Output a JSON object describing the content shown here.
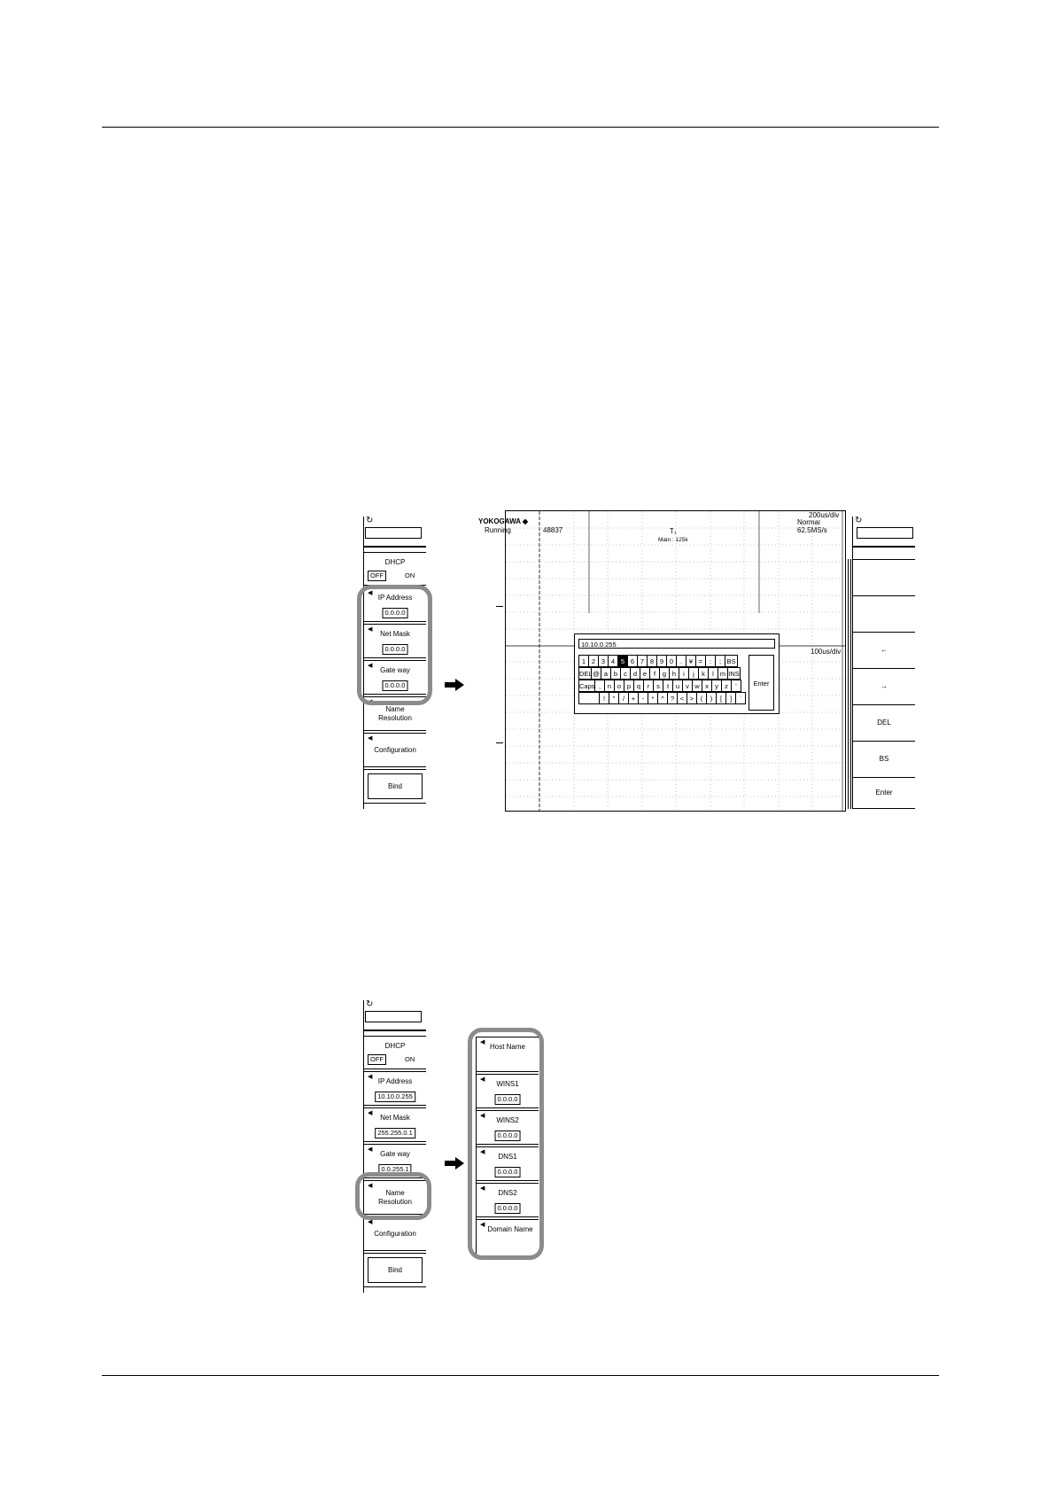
{
  "figure1": {
    "left_menu": {
      "dhcp": {
        "label": "DHCP",
        "off": "OFF",
        "on": "ON"
      },
      "ip_address": {
        "label": "IP Address",
        "value": "0.0.0.0"
      },
      "net_mask": {
        "label": "Net Mask",
        "value": "0.0.0.0"
      },
      "gate_way": {
        "label": "Gate way",
        "value": "0.0.0.0"
      },
      "name_resolution": {
        "line1": "Name",
        "line2": "Resolution"
      },
      "configuration": "Configuration",
      "bind": "Bind"
    },
    "screen": {
      "brand": "YOKOGAWA ◆",
      "status": "Running",
      "count": "48837",
      "trigger_mark": "T₁",
      "main_info": "Main : 125k",
      "mode": "Normal",
      "sample_rate": "62.5MS/s",
      "timebase_top": "200us/div",
      "timebase_mid": "100us/div"
    },
    "keyboard": {
      "entry": "10.10.0.255",
      "row1": [
        "1",
        "2",
        "3",
        "4",
        "5",
        "6",
        "7",
        "8",
        "9",
        "0",
        ".",
        "¥",
        "=",
        ":",
        ";",
        "BS"
      ],
      "row2": [
        "DEL",
        "@",
        "a",
        "b",
        "c",
        "d",
        "e",
        "f",
        "g",
        "h",
        "i",
        "j",
        "k",
        "l",
        "m",
        "INS"
      ],
      "row3": [
        "Caps",
        ",",
        "n",
        "o",
        "p",
        "q",
        "r",
        "s",
        "t",
        "u",
        "v",
        "w",
        "x",
        "y",
        "z",
        "'"
      ],
      "row4": [
        "",
        "!",
        "\"",
        "/",
        "+",
        "-",
        "*",
        "^",
        "?",
        "<",
        ">",
        "(",
        ")",
        "[",
        "]",
        "`"
      ],
      "enter": "Enter",
      "selected_key": "5"
    },
    "right_menu": {
      "items": [
        "",
        "",
        "←",
        "→",
        "DEL",
        "BS",
        "Enter"
      ]
    }
  },
  "figure2": {
    "left_menu": {
      "dhcp": {
        "label": "DHCP",
        "off": "OFF",
        "on": "ON"
      },
      "ip_address": {
        "label": "IP Address",
        "value": "10.10.0.255"
      },
      "net_mask": {
        "label": "Net Mask",
        "value": "255.255.0.1"
      },
      "gate_way": {
        "label": "Gate way",
        "value": "0.0.255.1"
      },
      "name_resolution": {
        "line1": "Name",
        "line2": "Resolution"
      },
      "configuration": "Configuration",
      "bind": "Bind"
    },
    "name_resolution_menu": {
      "host_name": "Host Name",
      "wins1": {
        "label": "WINS1",
        "value": "0.0.0.0"
      },
      "wins2": {
        "label": "WINS2",
        "value": "0.0.0.0"
      },
      "dns1": {
        "label": "DNS1",
        "value": "0.0.0.0"
      },
      "dns2": {
        "label": "DNS2",
        "value": "0.0.0.0"
      },
      "domain_name": "Domain Name"
    }
  },
  "colors": {
    "highlight": "#8c8c8c",
    "line": "#000000"
  }
}
